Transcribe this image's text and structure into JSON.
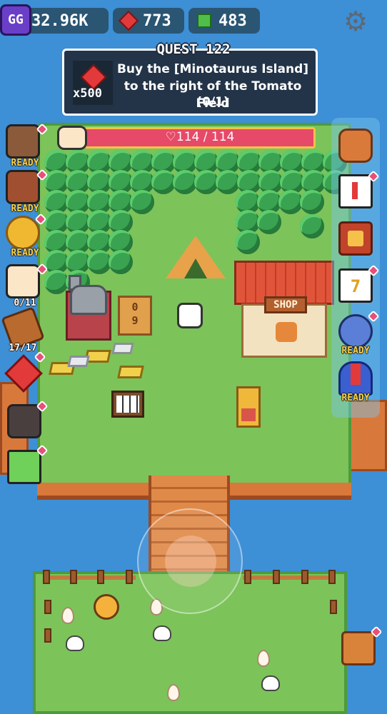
{
  "hud": {
    "gg_label": "GG",
    "coins": "32.96K",
    "gems": "773",
    "cubes": "483",
    "settings_icon": "gear-icon"
  },
  "quest": {
    "title": "QUEST 122",
    "description": "Buy the [Minotaurus Island] to the right of the Tomato Field",
    "progress": "(0/1)",
    "reward_count": "x500",
    "reward_icon": "red-gem-icon"
  },
  "health": {
    "label": "♡114 / 114",
    "current": 114,
    "max": 114
  },
  "left_buttons": [
    {
      "name": "raccoon-helper",
      "label": "READY"
    },
    {
      "name": "bear-helper",
      "label": "READY"
    },
    {
      "name": "tree-helper",
      "label": "READY"
    },
    {
      "name": "cat-helper",
      "label": "0/11"
    },
    {
      "name": "log-helper",
      "label": "17/17"
    },
    {
      "name": "red-gem",
      "label": ""
    },
    {
      "name": "coal-ore",
      "label": ""
    },
    {
      "name": "green-block",
      "label": ""
    }
  ],
  "right_buttons": [
    {
      "name": "backpack",
      "label": ""
    },
    {
      "name": "notice-board",
      "label": ""
    },
    {
      "name": "crown-book",
      "label": ""
    },
    {
      "name": "calendar",
      "label": "",
      "day": "7"
    },
    {
      "name": "heart-orb",
      "label": "READY"
    },
    {
      "name": "magnet",
      "label": "READY"
    }
  ],
  "world": {
    "shop_sign": "SHOP",
    "counter_sign_top": "0",
    "counter_sign_bottom": "9"
  }
}
